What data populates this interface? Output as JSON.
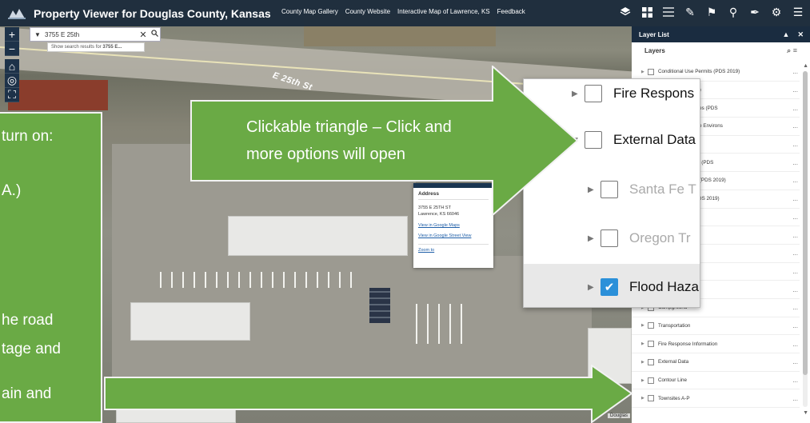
{
  "header": {
    "title": "Property Viewer for Douglas County, Kansas",
    "links": [
      "County Map Gallery",
      "County Website",
      "Interactive Map of Lawrence, KS",
      "Feedback"
    ],
    "tools": [
      "layers-icon",
      "grid-icon",
      "list-icon",
      "chart-icon",
      "graduation-cap-icon",
      "person-icon",
      "pencil-icon",
      "print-icon",
      "menu-icon"
    ]
  },
  "map": {
    "road_label": "E 25th St",
    "attribution": "Douglas"
  },
  "search": {
    "value": "3755 E 25th",
    "hint_prefix": "Show search results for ",
    "hint_bold": "3755 E..."
  },
  "popup": {
    "title": "Address",
    "address_line1": "3755 E 25TH ST",
    "address_line2": "Lawrence, KS 66046",
    "link_maps": "View in Google Maps",
    "link_street": "View in Google Street View",
    "link_zoom": "Zoom to"
  },
  "layer_list": {
    "title": "Layer List",
    "subtitle": "Layers",
    "rows": [
      {
        "label": "Conditional Use Permits (PDS 2019)",
        "more": "..."
      },
      {
        "label": "Zoning (PDS 2019)",
        "more": "..."
      },
      {
        "label": "ter of Historic Places (PDS",
        "more": "..."
      },
      {
        "label": "ter of Historic Place Environs",
        "more": "..."
      },
      {
        "label": "g (PDS 2019)",
        "more": "..."
      },
      {
        "label": "r of Historic Places (PDS",
        "more": "..."
      },
      {
        "label": "ric Kansas Places (PDS 2019)",
        "more": "..."
      },
      {
        "label": "res (Lawrence) (PDS 2019)",
        "more": "..."
      },
      {
        "label": "",
        "more": "..."
      },
      {
        "label": "",
        "more": "..."
      },
      {
        "label": "",
        "more": "..."
      },
      {
        "label": "reas",
        "more": "..."
      },
      {
        "label": "ay System",
        "more": "..."
      },
      {
        "label": "Campground",
        "more": "..."
      },
      {
        "label": "Transportation",
        "more": "..."
      },
      {
        "label": "Fire Response Information",
        "more": "..."
      },
      {
        "label": "External Data",
        "more": "..."
      },
      {
        "label": "Contour Line",
        "more": "..."
      },
      {
        "label": "Townsites A-P",
        "more": "..."
      }
    ]
  },
  "zoom_callout": {
    "rows": [
      {
        "label": "Fire Respons",
        "checked": false,
        "faded": false,
        "expanded": false
      },
      {
        "label": "External Data",
        "checked": false,
        "faded": false,
        "expanded": true
      },
      {
        "label": "Santa Fe T",
        "checked": false,
        "faded": true,
        "expanded": false
      },
      {
        "label": "Oregon Tr",
        "checked": false,
        "faded": true,
        "expanded": false
      },
      {
        "label": "Flood Haza",
        "checked": true,
        "faded": false,
        "expanded": false
      }
    ]
  },
  "callout_arrow": {
    "line1": "Clickable triangle – Click and",
    "line2": "more options will open"
  },
  "green_panel": {
    "lines": [
      "turn on:",
      "A.)",
      "he road",
      "tage and",
      "ain and"
    ]
  }
}
